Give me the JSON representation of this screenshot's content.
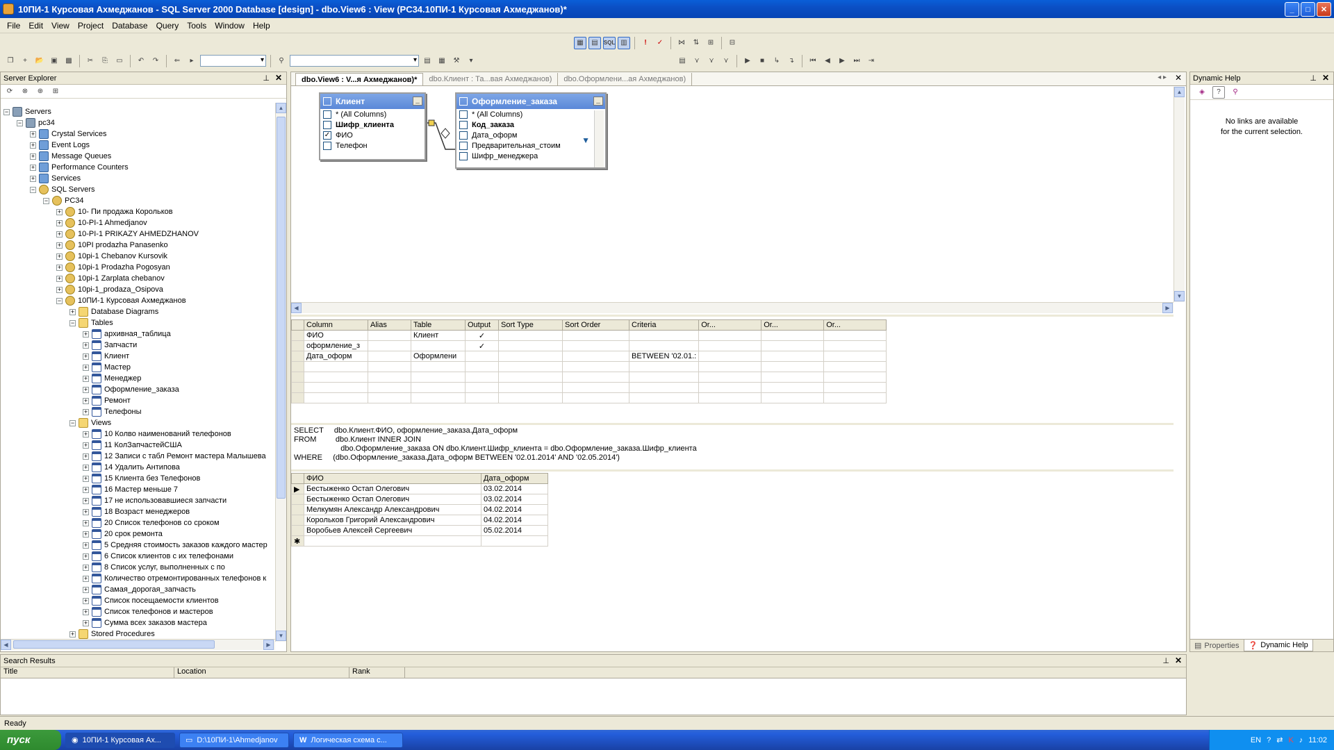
{
  "window": {
    "title": "10ПИ-1 Курсовая Ахмеджанов - SQL Server 2000 Database [design] - dbo.View6 : View (PC34.10ПИ-1 Курсовая Ахмеджанов)*"
  },
  "menu": [
    "File",
    "Edit",
    "View",
    "Project",
    "Database",
    "Query",
    "Tools",
    "Window",
    "Help"
  ],
  "server_explorer": {
    "title": "Server Explorer",
    "nodes": [
      {
        "label": "Servers",
        "depth": 0,
        "pm": "−",
        "icon": "srv"
      },
      {
        "label": "pc34",
        "depth": 1,
        "pm": "−",
        "icon": "srv"
      },
      {
        "label": "Crystal Services",
        "depth": 2,
        "pm": "+",
        "icon": "misc"
      },
      {
        "label": "Event Logs",
        "depth": 2,
        "pm": "+",
        "icon": "misc"
      },
      {
        "label": "Message Queues",
        "depth": 2,
        "pm": "+",
        "icon": "misc"
      },
      {
        "label": "Performance Counters",
        "depth": 2,
        "pm": "+",
        "icon": "misc"
      },
      {
        "label": "Services",
        "depth": 2,
        "pm": "+",
        "icon": "misc"
      },
      {
        "label": "SQL Servers",
        "depth": 2,
        "pm": "−",
        "icon": "db"
      },
      {
        "label": "PC34",
        "depth": 3,
        "pm": "−",
        "icon": "db"
      },
      {
        "label": "10- Пи продажа Корольков",
        "depth": 4,
        "pm": "+",
        "icon": "db"
      },
      {
        "label": "10-PI-1 Ahmedjanov",
        "depth": 4,
        "pm": "+",
        "icon": "db"
      },
      {
        "label": "10-PI-1 PRIKAZY AHMEDZHANOV",
        "depth": 4,
        "pm": "+",
        "icon": "db"
      },
      {
        "label": "10PI prodazha Panasenko",
        "depth": 4,
        "pm": "+",
        "icon": "db"
      },
      {
        "label": "10pi-1 Chebanov Kursovik",
        "depth": 4,
        "pm": "+",
        "icon": "db"
      },
      {
        "label": "10pi-1 Prodazha Pogosyan",
        "depth": 4,
        "pm": "+",
        "icon": "db"
      },
      {
        "label": "10pi-1 Zarplata chebanov",
        "depth": 4,
        "pm": "+",
        "icon": "db"
      },
      {
        "label": "10pi-1_prodaza_Osipova",
        "depth": 4,
        "pm": "+",
        "icon": "db"
      },
      {
        "label": "10ПИ-1 Курсовая Ахмеджанов",
        "depth": 4,
        "pm": "−",
        "icon": "db"
      },
      {
        "label": "Database Diagrams",
        "depth": 5,
        "pm": "+",
        "icon": "fold"
      },
      {
        "label": "Tables",
        "depth": 5,
        "pm": "−",
        "icon": "fold"
      },
      {
        "label": "архивная_таблица",
        "depth": 6,
        "pm": "+",
        "icon": "tbl"
      },
      {
        "label": "Запчасти",
        "depth": 6,
        "pm": "+",
        "icon": "tbl"
      },
      {
        "label": "Клиент",
        "depth": 6,
        "pm": "+",
        "icon": "tbl"
      },
      {
        "label": "Мастер",
        "depth": 6,
        "pm": "+",
        "icon": "tbl"
      },
      {
        "label": "Менеджер",
        "depth": 6,
        "pm": "+",
        "icon": "tbl"
      },
      {
        "label": "Оформление_заказа",
        "depth": 6,
        "pm": "+",
        "icon": "tbl"
      },
      {
        "label": "Ремонт",
        "depth": 6,
        "pm": "+",
        "icon": "tbl"
      },
      {
        "label": "Телефоны",
        "depth": 6,
        "pm": "+",
        "icon": "tbl"
      },
      {
        "label": "Views",
        "depth": 5,
        "pm": "−",
        "icon": "fold"
      },
      {
        "label": "10 Колво наименований телефонов",
        "depth": 6,
        "pm": "+",
        "icon": "tbl"
      },
      {
        "label": "11 КолЗапчастейСША",
        "depth": 6,
        "pm": "+",
        "icon": "tbl"
      },
      {
        "label": "12 Записи с табл Ремонт мастера Малышева",
        "depth": 6,
        "pm": "+",
        "icon": "tbl"
      },
      {
        "label": "14 Удалить Антипова",
        "depth": 6,
        "pm": "+",
        "icon": "tbl"
      },
      {
        "label": "15 Клиента без Телефонов",
        "depth": 6,
        "pm": "+",
        "icon": "tbl"
      },
      {
        "label": "16 Мастер меньше 7",
        "depth": 6,
        "pm": "+",
        "icon": "tbl"
      },
      {
        "label": "17 не использовавшиеся запчасти",
        "depth": 6,
        "pm": "+",
        "icon": "tbl"
      },
      {
        "label": "18 Возраст менеджеров",
        "depth": 6,
        "pm": "+",
        "icon": "tbl"
      },
      {
        "label": "20 Список телефонов со сроком",
        "depth": 6,
        "pm": "+",
        "icon": "tbl"
      },
      {
        "label": "20 срок ремонта",
        "depth": 6,
        "pm": "+",
        "icon": "tbl"
      },
      {
        "label": "5 Средняя стоимость заказов каждого мастер",
        "depth": 6,
        "pm": "+",
        "icon": "tbl"
      },
      {
        "label": "6 Список клиентов с их телефонами",
        "depth": 6,
        "pm": "+",
        "icon": "tbl"
      },
      {
        "label": "8 Список услуг, выполненных  с по",
        "depth": 6,
        "pm": "+",
        "icon": "tbl"
      },
      {
        "label": "Количество отремонтированных телефонов к",
        "depth": 6,
        "pm": "+",
        "icon": "tbl"
      },
      {
        "label": "Самая_дорогая_запчасть",
        "depth": 6,
        "pm": "+",
        "icon": "tbl"
      },
      {
        "label": "Список посещаемости клиентов",
        "depth": 6,
        "pm": "+",
        "icon": "tbl"
      },
      {
        "label": "Список телефонов и мастеров",
        "depth": 6,
        "pm": "+",
        "icon": "tbl"
      },
      {
        "label": "Сумма всех заказов мастера",
        "depth": 6,
        "pm": "+",
        "icon": "tbl"
      },
      {
        "label": "Stored Procedures",
        "depth": 5,
        "pm": "+",
        "icon": "fold"
      }
    ]
  },
  "tabs": [
    {
      "label": "dbo.View6 : V...я Ахмеджанов)*",
      "active": true
    },
    {
      "label": "dbo.Клиент : Та...вая Ахмеджанов)",
      "active": false
    },
    {
      "label": "dbo.Оформлени...ая Ахмеджанов)",
      "active": false
    }
  ],
  "diagram": {
    "table1": {
      "name": "Клиент",
      "columns": [
        {
          "label": "* (All Columns)",
          "checked": false,
          "bold": false
        },
        {
          "label": "Шифр_клиента",
          "checked": false,
          "bold": true
        },
        {
          "label": "ФИО",
          "checked": true,
          "bold": false
        },
        {
          "label": "Телефон",
          "checked": false,
          "bold": false
        }
      ]
    },
    "table2": {
      "name": "Оформление_заказа",
      "columns": [
        {
          "label": "* (All Columns)",
          "checked": false,
          "bold": false
        },
        {
          "label": "Код_заказа",
          "checked": false,
          "bold": true
        },
        {
          "label": "Дата_оформ",
          "checked": false,
          "bold": false
        },
        {
          "label": "Предварительная_стоим",
          "checked": false,
          "bold": false
        },
        {
          "label": "Шифр_менеджера",
          "checked": false,
          "bold": false
        }
      ]
    }
  },
  "criteria_grid": {
    "headers": [
      "Column",
      "Alias",
      "Table",
      "Output",
      "Sort Type",
      "Sort Order",
      "Criteria",
      "Or...",
      "Or...",
      "Or..."
    ],
    "rows": [
      [
        "ФИО",
        "",
        "Клиент",
        "✓",
        "",
        "",
        "",
        "",
        "",
        ""
      ],
      [
        "оформление_з",
        "",
        "",
        "✓",
        "",
        "",
        "",
        "",
        "",
        ""
      ],
      [
        "Дата_оформ",
        "",
        "Оформлени",
        "",
        "",
        "",
        "BETWEEN '02.01.:",
        "",
        "",
        ""
      ],
      [
        "",
        "",
        "",
        "",
        "",
        "",
        "",
        "",
        "",
        ""
      ],
      [
        "",
        "",
        "",
        "",
        "",
        "",
        "",
        "",
        "",
        ""
      ],
      [
        "",
        "",
        "",
        "",
        "",
        "",
        "",
        "",
        "",
        ""
      ],
      [
        "",
        "",
        "",
        "",
        "",
        "",
        "",
        "",
        "",
        ""
      ]
    ]
  },
  "sql": {
    "lines": [
      "SELECT     dbo.Клиент.ФИО, оформление_заказа.Дата_оформ",
      "FROM         dbo.Клиент INNER JOIN",
      "                      dbo.Оформление_заказа ON dbo.Клиент.Шифр_клиента = dbo.Оформление_заказа.Шифр_клиента",
      "WHERE     (dbo.Оформление_заказа.Дата_оформ BETWEEN '02.01.2014' AND '02.05.2014')"
    ]
  },
  "results": {
    "headers": [
      "ФИО",
      "Дата_оформ"
    ],
    "rows": [
      [
        "Бестыженко Остап Олегович",
        "03.02.2014"
      ],
      [
        "Бестыженко Остап Олегович",
        "03.02.2014"
      ],
      [
        "Мелкумян Александр Александрович",
        "04.02.2014"
      ],
      [
        "Корольков Григорий Александрович",
        "04.02.2014"
      ],
      [
        "Воробьев Алексей Сергеевич",
        "05.02.2014"
      ]
    ],
    "new_row_marker": "✱"
  },
  "dynamic_help": {
    "title": "Dynamic Help",
    "message_line1": "No links are available",
    "message_line2": "for the current selection.",
    "tab_properties": "Properties",
    "tab_dynamic_help": "Dynamic Help"
  },
  "search_results": {
    "title": "Search Results",
    "headers": [
      "Title",
      "Location",
      "Rank"
    ]
  },
  "status": {
    "text": "Ready"
  },
  "taskbar": {
    "start": "пуск",
    "tasks": [
      "10ПИ-1 Курсовая Ах...",
      "D:\\10ПИ-1\\Ahmedjanov",
      "Логическая схема с..."
    ],
    "lang": "EN",
    "clock": "11:02"
  }
}
